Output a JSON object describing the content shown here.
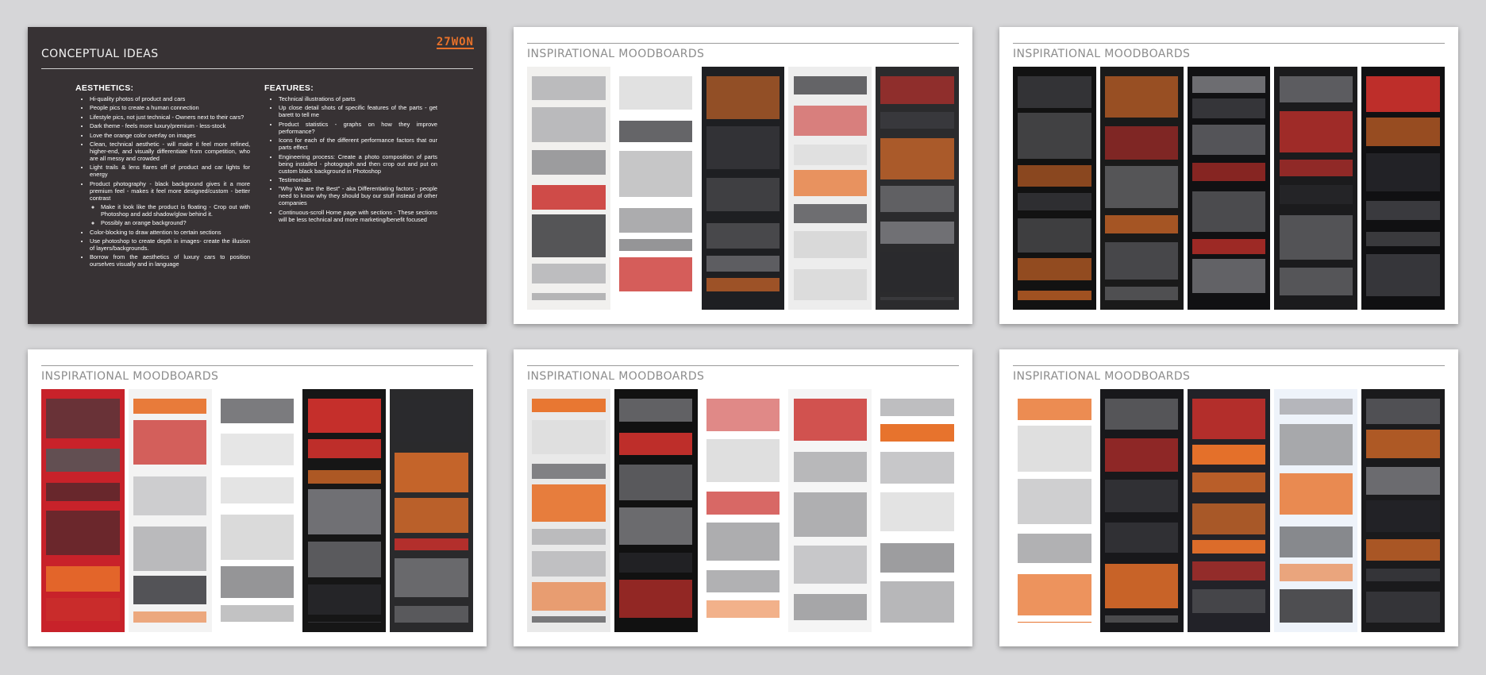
{
  "conceptual": {
    "title": "CONCEPTUAL IDEAS",
    "logo_text": "27WON",
    "aesthetics": {
      "heading": "AESTHETICS:",
      "items": [
        "Hi-quality photos of product and cars",
        "People pics to create a human connection",
        "Lifestyle pics, not just technical - Owners next to their cars?",
        "Dark theme - feels more luxury/premium - less-stock",
        "Love the orange color overlay on images",
        "Clean, technical aesthetic - will make it feel more refined, higher-end, and visually differentiate from competition, who are all messy and crowded",
        "Light trails & lens flares off of product and car lights for energy",
        "Product photography - black background gives it a more premium feel - makes it feel more designed/custom - better contrast",
        "Color-blocking to draw attention to certain sections",
        "Use photoshop to create depth in images- create the illusion of layers/backgrounds.",
        "Borrow from the aesthetics of luxury cars to position ourselves visually and in language"
      ],
      "sub_items": [
        "Make it look like the product is floating - Crop out with Photoshop and add shadow/glow behind it.",
        "Possibly an orange background?"
      ]
    },
    "features": {
      "heading": "FEATURES:",
      "items": [
        "Technical illustrations of parts",
        "Up close detail shots of specific features of the parts - get barett to tell me",
        "Product statistics - graphs on how they improve performance?",
        "Icons for each of the different performance factors that our parts effect",
        "Engineering process: Create a photo composition of parts being installed - photograph and then crop out and put on custom black background in Photoshop",
        "Testimonials",
        "\"Why We are the Best\" - aka Differentiating factors - people need to know why they should buy our stuff instead of other companies",
        "Continuous-scroll Home page with sections - These sections will be less technical and more marketing/benefit focused"
      ]
    }
  },
  "moodboards": [
    {
      "title": "INSPIRATIONAL MOODBOARDS",
      "panels": [
        "#f1f0ee",
        "#ffffff",
        "#1e1f22",
        "#ededed",
        "#2b2b2d"
      ]
    },
    {
      "title": "INSPIRATIONAL MOODBOARDS",
      "panels": [
        "#121212",
        "#1a1a1a",
        "#111113",
        "#1b1b1d",
        "#101012"
      ]
    },
    {
      "title": "INSPIRATIONAL MOODBOARDS",
      "panels": [
        "#c8222a",
        "#f3f3f3",
        "#ffffff",
        "#161616",
        "#2a2a2c"
      ]
    },
    {
      "title": "INSPIRATIONAL MOODBOARDS",
      "panels": [
        "#e9e9e9",
        "#111111",
        "#ffffff",
        "#f5f5f5",
        "#ffffff"
      ]
    },
    {
      "title": "INSPIRATIONAL MOODBOARDS",
      "panels": [
        "#ffffff",
        "#18181b",
        "#222228",
        "#eef3fa",
        "#1a1a1c"
      ]
    }
  ]
}
